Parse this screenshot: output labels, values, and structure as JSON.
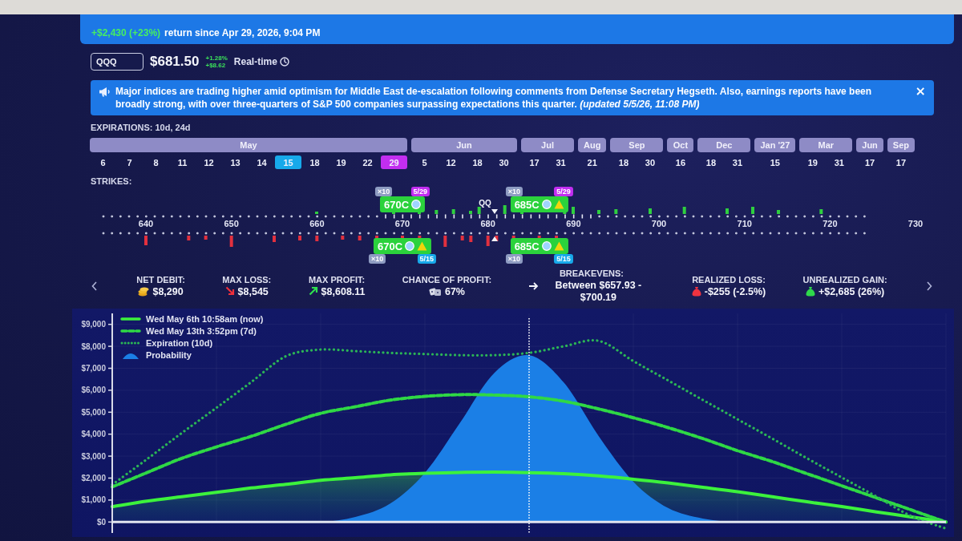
{
  "return_banner": {
    "gain": "+$2,430 (+23%)",
    "text": "return since Apr 29, 2026, 9:04 PM"
  },
  "ticker": {
    "symbol": "QQQ",
    "price": "$681.50",
    "change_percent": "+1.28%",
    "change_amount": "+$8.62",
    "feed": "Real-time"
  },
  "news": {
    "text": "Major indices are trading higher amid optimism for Middle East de-escalation following comments from Defense Secretary Hegseth. Also, earnings reports have been broadly strong, with over three-quarters of S&P 500 companies surpassing expectations this quarter. *(updated 5/5/26, 11:08 PM)*",
    "close": "×"
  },
  "expirations": {
    "label": "EXPIRATIONS: 10d, 24d",
    "months": [
      {
        "label": "May",
        "dates": [
          {
            "label": "6",
            "selected": false
          },
          {
            "label": "7",
            "selected": false
          },
          {
            "label": "8",
            "selected": false
          },
          {
            "label": "11",
            "selected": false
          },
          {
            "label": "12",
            "selected": false
          },
          {
            "label": "13",
            "selected": false
          },
          {
            "label": "14",
            "selected": false
          },
          {
            "label": "15",
            "selected": true,
            "color": "#17a9ea"
          },
          {
            "label": "18",
            "selected": false
          },
          {
            "label": "19",
            "selected": false
          },
          {
            "label": "22",
            "selected": false
          },
          {
            "label": "29",
            "selected": true,
            "color": "#c22ef0"
          }
        ]
      },
      {
        "label": "Jun",
        "dates": [
          {
            "label": "5",
            "selected": false
          },
          {
            "label": "12",
            "selected": false
          },
          {
            "label": "18",
            "selected": false
          },
          {
            "label": "30",
            "selected": false
          }
        ]
      },
      {
        "label": "Jul",
        "dates": [
          {
            "label": "17",
            "selected": false
          },
          {
            "label": "31",
            "selected": false
          }
        ]
      },
      {
        "label": "Aug",
        "dates": [
          {
            "label": "21",
            "selected": false
          }
        ]
      },
      {
        "label": "Sep",
        "dates": [
          {
            "label": "18",
            "selected": false
          },
          {
            "label": "30",
            "selected": false
          }
        ]
      },
      {
        "label": "Oct",
        "dates": [
          {
            "label": "16",
            "selected": false
          }
        ]
      },
      {
        "label": "Dec",
        "dates": [
          {
            "label": "18",
            "selected": false
          },
          {
            "label": "31",
            "selected": false
          }
        ]
      },
      {
        "label": "Jan '27",
        "dates": [
          {
            "label": "15",
            "selected": false
          }
        ]
      },
      {
        "label": "Mar",
        "dates": [
          {
            "label": "19",
            "selected": false
          },
          {
            "label": "31",
            "selected": false
          }
        ]
      },
      {
        "label": "Jun",
        "dates": [
          {
            "label": "17",
            "selected": false
          }
        ]
      },
      {
        "label": "Sep",
        "dates": [
          {
            "label": "17",
            "selected": false
          }
        ]
      }
    ]
  },
  "strikes": {
    "label": "STRIKES:",
    "ticks": [
      "640",
      "650",
      "660",
      "670",
      "680",
      "690",
      "700",
      "710",
      "720",
      "730"
    ],
    "price_marker": "QQ",
    "top_legs": [
      {
        "label": "670C",
        "quantity": "×10",
        "expiry": "5/29",
        "color": "#c22ef0",
        "warning": false
      },
      {
        "label": "685C",
        "quantity": "×10",
        "expiry": "5/29",
        "color": "#c22ef0",
        "warning": true
      }
    ],
    "bottom_legs": [
      {
        "label": "670C",
        "quantity": "×10",
        "expiry": "5/15",
        "color": "#17a9ea",
        "warning": true
      },
      {
        "label": "685C",
        "quantity": "×10",
        "expiry": "5/15",
        "color": "#17a9ea",
        "warning": true
      }
    ]
  },
  "stats": [
    {
      "label": "NET DEBIT:",
      "value": "$8,290"
    },
    {
      "label": "MAX LOSS:",
      "value": "$8,545"
    },
    {
      "label": "MAX PROFIT:",
      "value": "$8,608.11"
    },
    {
      "label": "CHANCE OF PROFIT:",
      "value": "67%"
    },
    {
      "label": "BREAKEVENS:",
      "value": "Between $657.93 - $700.19"
    },
    {
      "label": "REALIZED LOSS:",
      "value": "-$255 (-2.5%)"
    },
    {
      "label": "UNREALIZED GAIN:",
      "value": "+$2,685 (26%)"
    }
  ],
  "chart": {
    "chart_data": {
      "type": "line",
      "legend": "upper left",
      "grid": true,
      "ylim": [
        -500,
        9500
      ],
      "yticks": [
        {
          "value": 0,
          "label": "$0"
        },
        {
          "value": 1000,
          "label": "$1,000"
        },
        {
          "value": 2000,
          "label": "$2,000"
        },
        {
          "value": 3000,
          "label": "$3,000"
        },
        {
          "value": 4000,
          "label": "$4,000"
        },
        {
          "value": 5000,
          "label": "$5,000"
        },
        {
          "value": 6000,
          "label": "$6,000"
        },
        {
          "value": 7000,
          "label": "$7,000"
        },
        {
          "value": 8000,
          "label": "$8,000"
        },
        {
          "value": 9000,
          "label": "$9,000"
        }
      ],
      "categories": [
        null,
        null,
        null,
        null,
        null,
        null,
        null,
        null,
        null,
        null,
        null,
        null,
        null,
        null,
        null,
        null,
        null,
        null,
        null,
        null,
        null,
        null,
        null,
        null,
        null
      ],
      "series": [
        {
          "name": "Wed May 6th 10:58am (now)",
          "type": "area",
          "line_style": "solid",
          "color": "#3cf23c",
          "values": [
            700,
            950,
            1150,
            1350,
            1550,
            1720,
            1900,
            2020,
            2150,
            2220,
            2260,
            2270,
            2250,
            2200,
            2100,
            1950,
            1780,
            1580,
            1380,
            1150,
            920,
            700,
            460,
            230,
            0
          ]
        },
        {
          "name": "Wed May 13th 3:52pm (7d)",
          "type": "line",
          "line_style": "dashed",
          "color": "#2fd845",
          "values": [
            1600,
            2250,
            2900,
            3420,
            3900,
            4450,
            4950,
            5250,
            5550,
            5720,
            5800,
            5780,
            5700,
            5500,
            5150,
            4750,
            4300,
            3800,
            3250,
            2750,
            2200,
            1650,
            1100,
            550,
            0
          ]
        },
        {
          "name": "Expiration (10d)",
          "type": "line",
          "line_style": "dotted",
          "color": "#2bb556",
          "values": [
            1700,
            2860,
            4050,
            5200,
            6370,
            7550,
            7850,
            7780,
            7700,
            7650,
            7600,
            7600,
            7700,
            8000,
            8250,
            7330,
            6450,
            5560,
            4680,
            3800,
            2900,
            2030,
            1160,
            270,
            -300
          ]
        },
        {
          "name": "Probability",
          "type": "area",
          "color": "#1b7fe6",
          "values": [
            0,
            0,
            0,
            0,
            0,
            0,
            0,
            230,
            840,
            2240,
            4490,
            6790,
            7590,
            6350,
            3920,
            1840,
            640,
            160,
            0,
            0,
            0,
            0,
            0,
            0,
            0
          ]
        }
      ]
    }
  }
}
